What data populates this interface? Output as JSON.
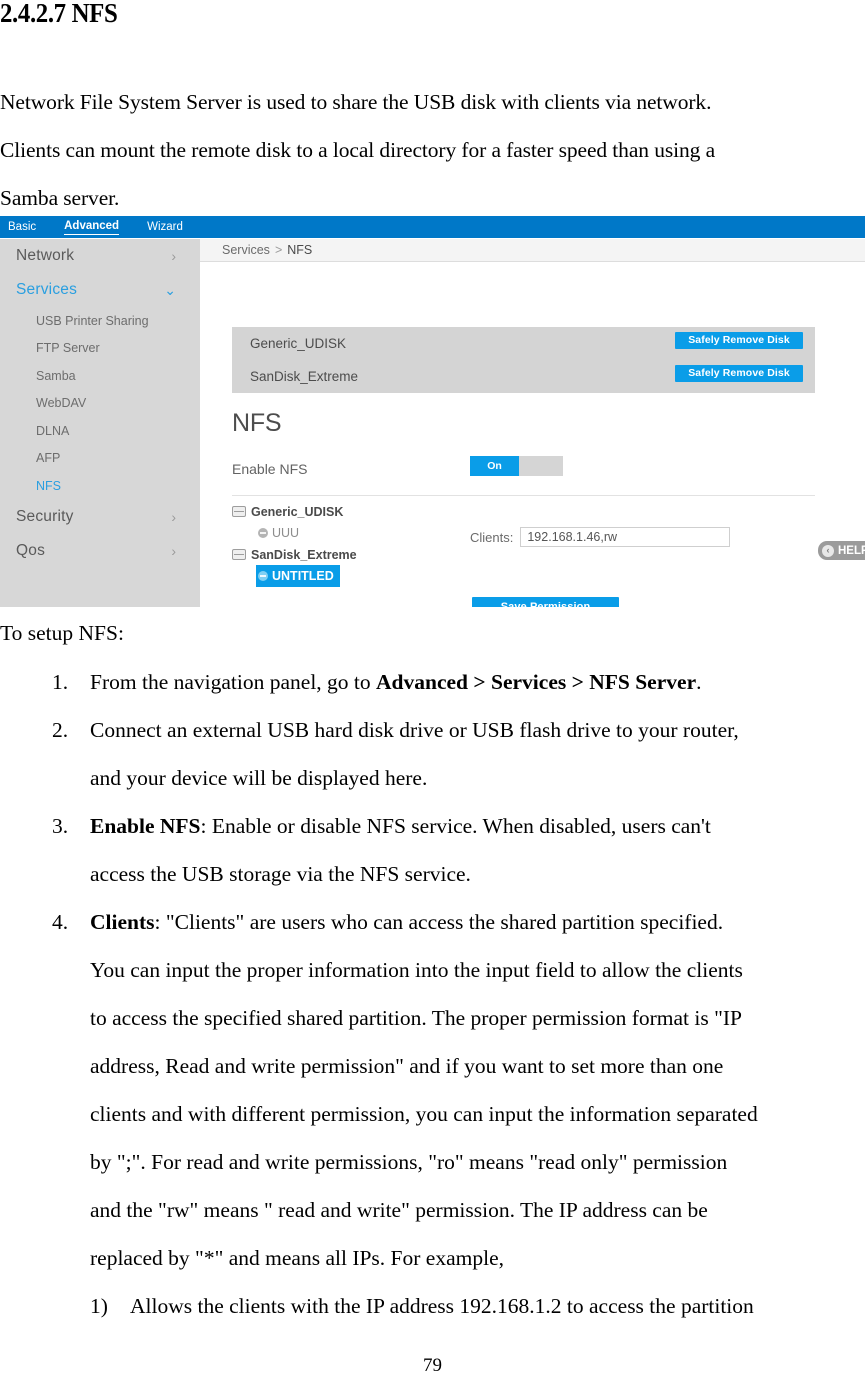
{
  "document": {
    "heading": "2.4.2.7 NFS",
    "intro_lines": [
      "Network File System Server is used to share the USB disk with clients via network.",
      "Clients can mount the remote disk to a local directory for a faster speed than using a",
      "Samba server."
    ],
    "setup_lead": "To setup NFS:",
    "page_number": "79",
    "steps": [
      {
        "num": "1.",
        "prefix": "From the navigation panel, go to ",
        "bold": "Advanced > Services > NFS Server",
        "suffix": "."
      },
      {
        "num": "2.",
        "lines": [
          "Connect an external USB hard disk drive or USB flash drive to your router,",
          "and your device will be displayed here."
        ]
      },
      {
        "num": "3.",
        "bold": "Enable NFS",
        "lines": [
          ": Enable or disable NFS service. When disabled, users can't",
          "access the USB storage via the NFS service."
        ]
      },
      {
        "num": "4.",
        "bold": "Clients",
        "lines": [
          ": \"Clients\" are users who can access the shared partition specified.",
          "You can input the proper information into the input field to allow the clients",
          "to access the specified shared partition. The proper permission format is \"IP",
          "address, Read and write permission\" and if you want to set more than one",
          "clients and with different permission, you can input the information separated",
          "by \";\". For read and write permissions, \"ro\" means \"read only\" permission",
          "and the \"rw\" means \" read and write\" permission. The IP address can be",
          "replaced by \"*\" and means all IPs. For example,"
        ],
        "substeps": [
          {
            "num": "1)",
            "text": "Allows the clients with the IP address 192.168.1.2 to access the partition"
          }
        ]
      }
    ]
  },
  "router_ui": {
    "topnav": {
      "tabs": [
        {
          "label": "Basic",
          "active": false
        },
        {
          "label": "Advanced",
          "active": true
        },
        {
          "label": "Wizard",
          "active": false
        }
      ]
    },
    "sidebar": {
      "groups": [
        {
          "label": "Network",
          "state": "collapsed",
          "chevron": "›"
        },
        {
          "label": "Services",
          "state": "expanded",
          "chevron": "⌄"
        }
      ],
      "services_items": [
        {
          "label": "USB Printer Sharing",
          "selected": false
        },
        {
          "label": "FTP Server",
          "selected": false
        },
        {
          "label": "Samba",
          "selected": false
        },
        {
          "label": "WebDAV",
          "selected": false
        },
        {
          "label": "DLNA",
          "selected": false
        },
        {
          "label": "AFP",
          "selected": false
        },
        {
          "label": "NFS",
          "selected": true
        }
      ],
      "trailing_groups": [
        {
          "label": "Security",
          "chevron": "›"
        },
        {
          "label": "Qos",
          "chevron": "›"
        }
      ]
    },
    "breadcrumb": {
      "parent": "Services",
      "separator": ">",
      "current": "NFS"
    },
    "disks": [
      {
        "name": "Generic_UDISK",
        "button": "Safely Remove Disk"
      },
      {
        "name": "SanDisk_Extreme",
        "button": "Safely Remove Disk"
      }
    ],
    "help_tab": {
      "label": "HELP",
      "icon_glyph": "‹"
    },
    "section": {
      "title": "NFS",
      "enable_label": "Enable NFS",
      "toggle_state": "On"
    },
    "tree": [
      {
        "disk": "Generic_UDISK",
        "partitions": [
          {
            "label": "UUU",
            "selected": false
          }
        ]
      },
      {
        "disk": "SanDisk_Extreme",
        "partitions": [
          {
            "label": "UNTITLED",
            "selected": true
          }
        ]
      }
    ],
    "clients": {
      "label": "Clients:",
      "value": "192.168.1.46,rw",
      "placeholder": ""
    },
    "save_button": "Save Permission",
    "colors": {
      "nav_blue": "#0078c8",
      "accent_blue": "#0a9de8",
      "link_blue": "#2a9fe0",
      "sidebar_gray": "#d7d7d7",
      "panel_gray": "#d4d4d4"
    }
  }
}
